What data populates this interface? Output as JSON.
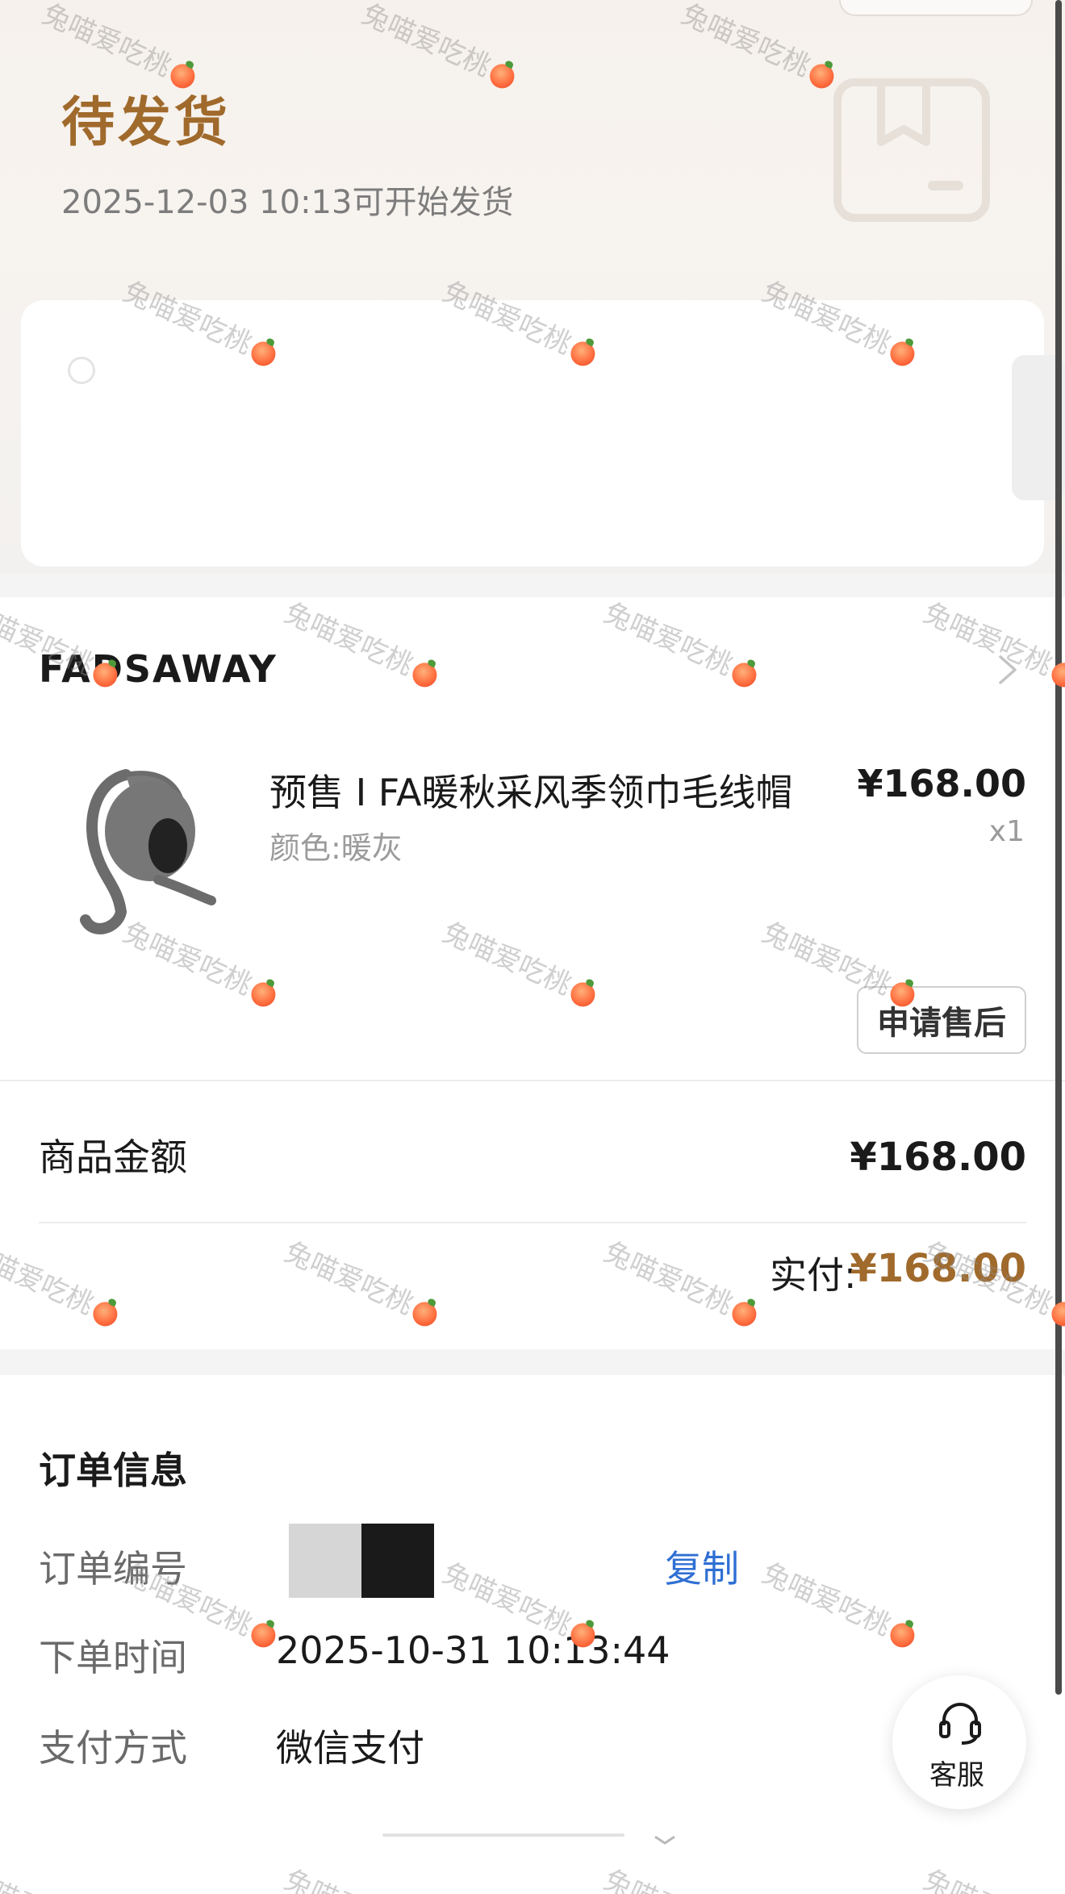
{
  "order_status": {
    "title": "待发货",
    "subtitle": "2025-12-03 10:13可开始发货"
  },
  "shop": {
    "name": "FADSAWAY"
  },
  "product": {
    "title": "预售 I FA暖秋采风季领巾毛线帽",
    "variant": "颜色:暖灰",
    "price": "¥168.00",
    "quantity": "x1",
    "after_sale_label": "申请售后"
  },
  "payment_summary": {
    "goods_amount_label": "商品金额",
    "goods_amount_value": "¥168.00",
    "paid_label": "实付:",
    "paid_value": "¥168.00"
  },
  "order_info": {
    "title": "订单信息",
    "order_number_label": "订单编号",
    "copy_label": "复制",
    "order_time_label": "下单时间",
    "order_time_value": "2025-10-31 10:13:44",
    "pay_method_label": "支付方式",
    "pay_method_value": "微信支付"
  },
  "customer_service": {
    "label": "客服"
  },
  "watermark": {
    "text": "兔喵爱吃桃"
  },
  "colors": {
    "accent": "#a06a2c",
    "link": "#2f6fd4"
  },
  "icons": {
    "status": "package-box-icon",
    "shop_nav": "chevron-right-icon",
    "customer_service": "headset-icon"
  }
}
